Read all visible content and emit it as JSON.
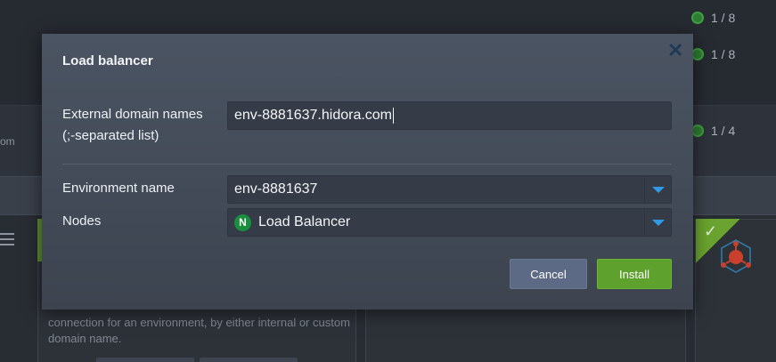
{
  "background": {
    "counters": [
      "1 / 8",
      "1 / 8",
      "1 / 4"
    ],
    "truncated_text": "om",
    "description": "connection for an environment, by either internal or custom domain name."
  },
  "dialog": {
    "title": "Load balancer",
    "fields": {
      "domains_label_line1": "External domain names",
      "domains_label_line2": "(;-separated list)",
      "domains_value": "env-8881637.hidora.com",
      "env_label": "Environment name",
      "env_value": "env-8881637",
      "nodes_label": "Nodes",
      "nodes_value": "Load Balancer",
      "nodes_icon_letter": "N"
    },
    "buttons": {
      "cancel": "Cancel",
      "install": "Install"
    }
  },
  "icons": {
    "close": "close-icon",
    "dropdown": "chevron-down-icon",
    "nginx": "nginx-icon",
    "check": "check-icon"
  },
  "colors": {
    "accent_blue": "#2f9be8",
    "install_green": "#5ea12c",
    "cancel": "#5c6a85"
  }
}
